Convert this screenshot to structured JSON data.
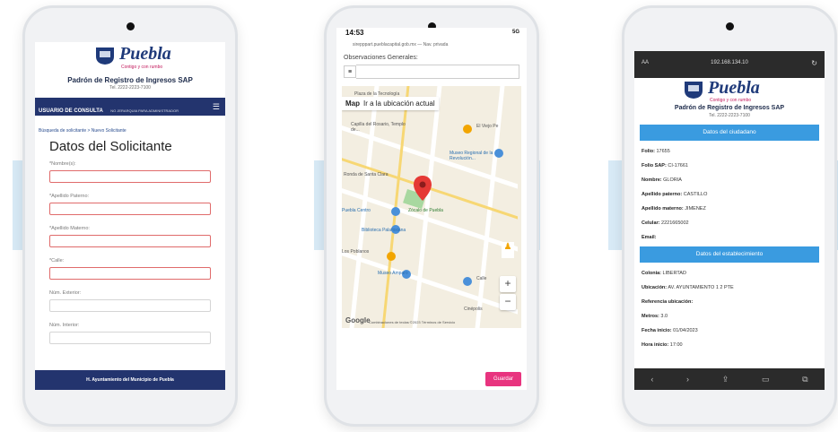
{
  "phone1": {
    "brand": {
      "name": "Puebla",
      "tagline": "Contigo y con rumbo",
      "title": "Padrón de Registro de Ingresos SAP",
      "tel": "Tel. 2222-2223-7100"
    },
    "nav": {
      "user": "USUARIO DE CONSULTA",
      "message": "NO JERARQUIA PARA ADMINISTRADOR",
      "sub": "PAGA"
    },
    "breadcrumb": "Búsqueda de solicitante > Nuevo Solicitante",
    "form_title": "Datos del Solicitante",
    "fields": [
      {
        "label": "*Nombre(s):",
        "error": true
      },
      {
        "label": "*Apellido Paterno:",
        "error": true
      },
      {
        "label": "*Apellido Materno:",
        "error": true
      },
      {
        "label": "*Calle:",
        "error": true
      },
      {
        "label": "Núm. Exterior:",
        "error": false
      },
      {
        "label": "Núm. Interior:",
        "error": false
      }
    ],
    "footer": "H. Ayuntamiento del Municipio de Puebla"
  },
  "phone2": {
    "status_time": "14:53",
    "status_icons": "5G",
    "url": "sirepppart.pueblacapital.gob.mx — Nav. privada",
    "obs_label": "Observaciones Generales:",
    "map_type": "Map",
    "map_action": "Ir a la ubicación actual",
    "map_labels": [
      {
        "text": "Plaza de la Tecnología",
        "cls": ""
      },
      {
        "text": "Capilla del Rosario, Templo de...",
        "cls": ""
      },
      {
        "text": "El Viejo Pe",
        "cls": ""
      },
      {
        "text": "Museo Regional de la Revolución...",
        "cls": "blue"
      },
      {
        "text": "Ronda de Santa Clara",
        "cls": ""
      },
      {
        "text": "Puebla Centro",
        "cls": "blue"
      },
      {
        "text": "Zócalo de Puebla",
        "cls": "green"
      },
      {
        "text": "Biblioteca Palafoxiana",
        "cls": "blue"
      },
      {
        "text": "Los Poblanos",
        "cls": ""
      },
      {
        "text": "Museo Amparo",
        "cls": "blue"
      },
      {
        "text": "Calle",
        "cls": ""
      },
      {
        "text": "Cinépolis",
        "cls": ""
      }
    ],
    "zoom_in": "+",
    "zoom_out": "−",
    "google": "Google",
    "attribution": "Combinaciones de teclas  ©2023  Términos de Servicio",
    "save_button": "Guardar"
  },
  "phone3": {
    "aa": "AA",
    "address": "192.168.134.10",
    "brand": {
      "name": "Puebla",
      "tagline": "Contigo y con rumbo",
      "title": "Padrón de Registro de Ingresos SAP",
      "tel": "Tel. 2222-2223-7100"
    },
    "section_citizen": "Datos del ciudadano",
    "citizen": [
      {
        "k": "Folio:",
        "v": "17655"
      },
      {
        "k": "Folio SAP:",
        "v": "CI-17661"
      },
      {
        "k": "Nombre:",
        "v": "GLORIA"
      },
      {
        "k": "Apellido paterno:",
        "v": "CASTILLO"
      },
      {
        "k": "Apellido materno:",
        "v": "JIMENEZ"
      },
      {
        "k": "Celular:",
        "v": "2221665002"
      },
      {
        "k": "Email:",
        "v": ""
      }
    ],
    "section_business": "Datos del establecimiento",
    "business": [
      {
        "k": "Colonia:",
        "v": "LIBERTAD"
      },
      {
        "k": "Ubicación:",
        "v": "AV. AYUNTAMIENTO 1 2 PTE"
      },
      {
        "k": "Referencia ubicación:",
        "v": ""
      },
      {
        "k": "Metros:",
        "v": "3.0"
      },
      {
        "k": "Fecha inicio:",
        "v": "01/04/2023"
      },
      {
        "k": "Hora inicio:",
        "v": "17:00"
      }
    ]
  }
}
